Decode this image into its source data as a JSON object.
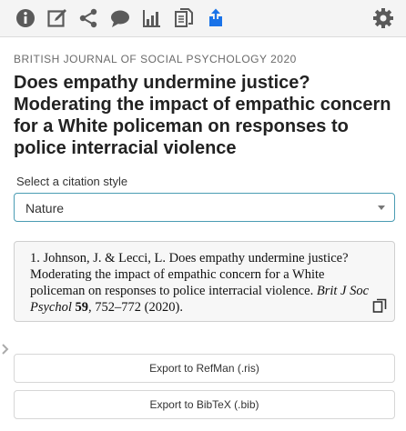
{
  "toolbar": {
    "icons": [
      "info-icon",
      "edit-icon",
      "share-icon",
      "comment-icon",
      "chart-icon",
      "documents-icon",
      "export-icon",
      "gear-icon"
    ],
    "accent_color": "#1a73e8",
    "icon_color": "#555555"
  },
  "article": {
    "journal": "BRITISH JOURNAL OF SOCIAL PSYCHOLOGY 2020",
    "title": "Does empathy undermine justice? Moderating the impact of empathic concern for a White policeman on responses to police interracial violence"
  },
  "citation_style": {
    "label": "Select a citation style",
    "selected": "Nature"
  },
  "citation": {
    "prefix": "1. Johnson, J. & Lecci, L. Does empathy undermine justice? Moderating the impact of empathic concern for a White policeman on responses to police interracial violence. ",
    "journal_abbrev": "Brit J Soc Psychol",
    "volume": "59",
    "suffix": ", 752–772 (2020)."
  },
  "buttons": {
    "export_ris": "Export to RefMan (.ris)",
    "export_bib": "Export to BibTeX (.bib)"
  }
}
